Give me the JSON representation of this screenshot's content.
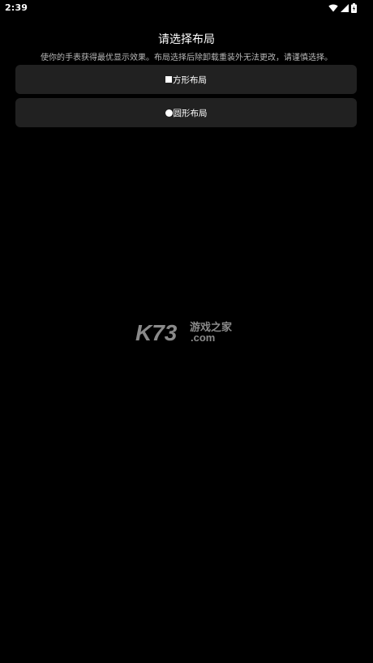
{
  "status_bar": {
    "time": "2:39",
    "icons": [
      "wifi-icon",
      "cellular-signal-icon",
      "battery-icon"
    ]
  },
  "page": {
    "title": "请选择布局",
    "subtitle": "使你的手表获得最优显示效果。布局选择后除卸载重装外无法更改，请谨慎选择。"
  },
  "options": [
    {
      "glyph": "square-icon",
      "label": "方形布局"
    },
    {
      "glyph": "circle-icon",
      "label": "圆形布局"
    }
  ],
  "watermark": {
    "brand": "K73",
    "cn_text": "游戏之家",
    "domain": ".com"
  },
  "colors": {
    "background": "#000000",
    "button_bg": "#212121",
    "text": "#ffffff",
    "subtitle_text": "#b8b8b8",
    "watermark": "#8a8a8a"
  }
}
